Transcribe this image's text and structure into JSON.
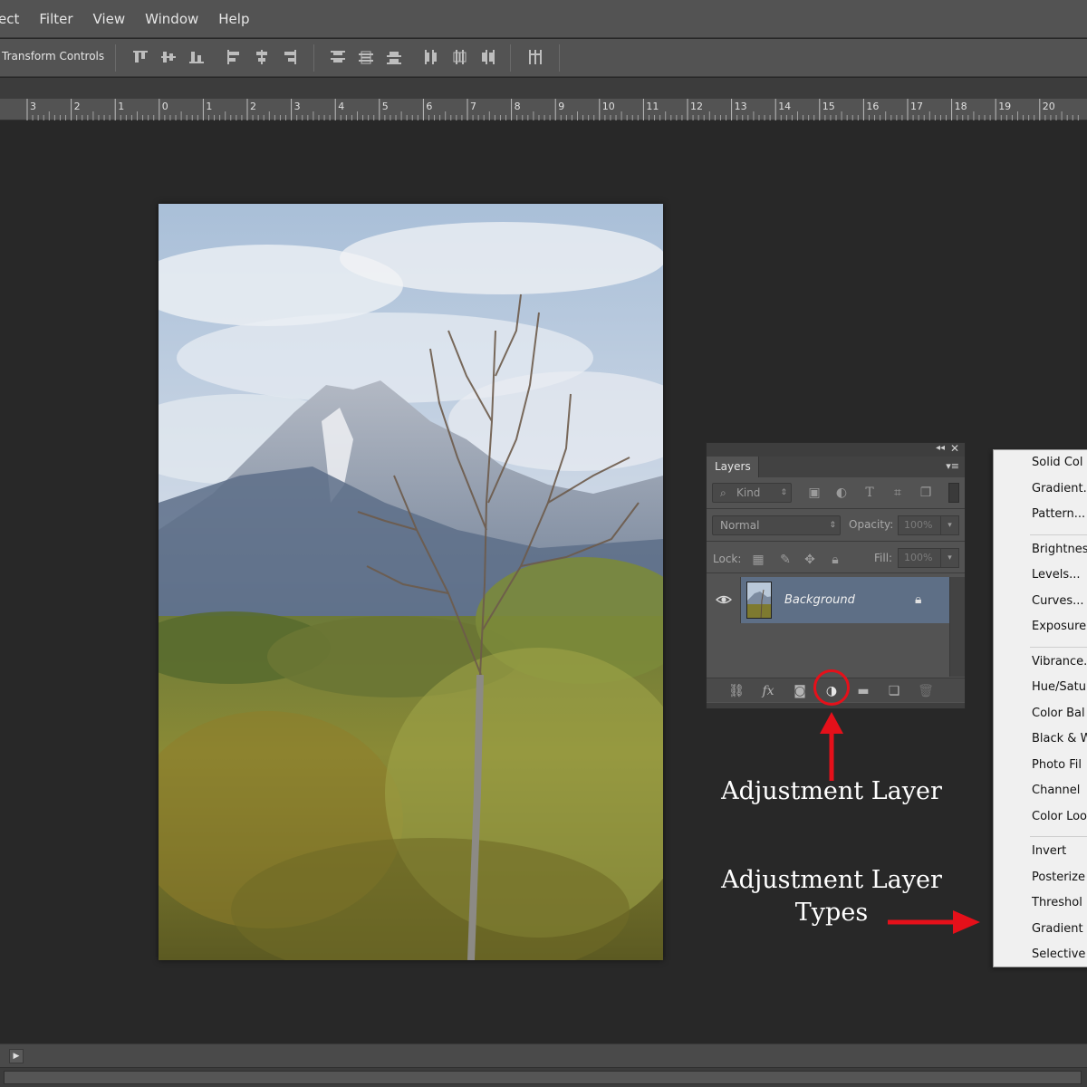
{
  "menubar": {
    "items": [
      "ect",
      "Filter",
      "View",
      "Window",
      "Help"
    ]
  },
  "options_bar": {
    "transform_controls_label": "Transform Controls",
    "icons": [
      "align-top-edges-icon",
      "align-vertical-centers-icon",
      "align-bottom-edges-icon",
      "align-left-edges-icon",
      "align-horizontal-centers-icon",
      "align-right-edges-icon",
      "distribute-top-icon",
      "distribute-vertical-centers-icon",
      "distribute-bottom-icon",
      "distribute-left-icon",
      "distribute-horizontal-centers-icon",
      "distribute-right-icon",
      "auto-align-layers-icon"
    ]
  },
  "ruler": {
    "labels": [
      "3",
      "2",
      "1",
      "0",
      "1",
      "2",
      "3",
      "4",
      "5",
      "6",
      "7",
      "8",
      "9",
      "10",
      "11",
      "12",
      "13",
      "14",
      "15",
      "16",
      "17",
      "18",
      "19",
      "20"
    ]
  },
  "layers_panel": {
    "title": "Layers",
    "collapse_glyph": "◂◂",
    "close_glyph": "✕",
    "menu_glyph": "▾≡",
    "filter_kind": "Kind",
    "blend_mode": "Normal",
    "opacity_label": "Opacity:",
    "opacity_value": "100%",
    "lock_label": "Lock:",
    "fill_label": "Fill:",
    "fill_value": "100%",
    "layer": {
      "name": "Background",
      "visible": true,
      "locked": true
    }
  },
  "annotations": {
    "adjustment_layer": "Adjustment Layer",
    "adjustment_layer_types_line1": "Adjustment Layer",
    "adjustment_layer_types_line2": "Types",
    "color": "#e5101a"
  },
  "adjustment_menu": {
    "groups": [
      [
        "Solid Col",
        "Gradient.",
        "Pattern..."
      ],
      [
        "Brightnes",
        "Levels...",
        "Curves...",
        "Exposure"
      ],
      [
        "Vibrance.",
        "Hue/Satu",
        "Color Bal",
        "Black & W",
        "Photo Fil",
        "Channel",
        "Color Loo"
      ],
      [
        "Invert",
        "Posterize",
        "Threshol",
        "Gradient",
        "Selective"
      ]
    ]
  },
  "colors": {
    "ui_panel": "#535353",
    "canvas_bg": "#282828",
    "selected_layer": "#5e6f86",
    "menu_bg": "#f0f0f0",
    "annotation_red": "#e5101a"
  }
}
